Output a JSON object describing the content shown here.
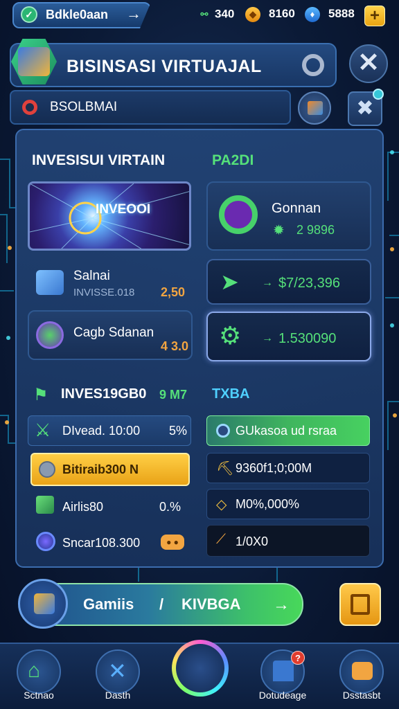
{
  "topbar": {
    "username": "Bdkle0aan",
    "stat_green": "340",
    "stat_gold": "8160",
    "stat_blue": "5888"
  },
  "header": {
    "title": "BISINSASI VIRTUAJAL",
    "subtitle": "BSOLBMAI"
  },
  "invest_section": {
    "title": "INVESISUI VIRTAIN",
    "side_title": "PA2DI",
    "banner_label": "INVEOOI",
    "items": [
      {
        "name": "Salnai",
        "sub": "INVISSE.018",
        "value": "2,50"
      },
      {
        "name": "Cagb Sdanan",
        "value": "4 3.0"
      }
    ],
    "right_cards": [
      {
        "title": "Gonnan",
        "value": "2 9896"
      },
      {
        "value": "$7/23,396"
      },
      {
        "value": "1.530090"
      }
    ]
  },
  "list_section": {
    "title": "INVES19GB0",
    "title_value": "9 M7",
    "side_title": "TXBA",
    "left_rows": [
      {
        "label": "DIvead. 10:00",
        "value": "5%"
      },
      {
        "label": "Bitiraib300 N"
      },
      {
        "label": "Airlis80",
        "value": "0.%"
      },
      {
        "label": "Sncar108.300"
      }
    ],
    "right_rows": [
      {
        "label": "GUkasoa ud rsraa"
      },
      {
        "label": "9360f1;0;00M"
      },
      {
        "label": "M0%,000%"
      },
      {
        "label": "1/0X0"
      }
    ]
  },
  "action": {
    "label_left": "Gamiis",
    "separator": "/",
    "label_right": "KIVBGA",
    "arrow": "→"
  },
  "nav": {
    "items": [
      "Sctnao",
      "Dasth",
      "Dotudeage",
      "Dsstasbt"
    ],
    "badge": "?"
  },
  "colors": {
    "accent_green": "#55e07a",
    "accent_gold": "#f2a541",
    "panel_blue": "#224478"
  }
}
